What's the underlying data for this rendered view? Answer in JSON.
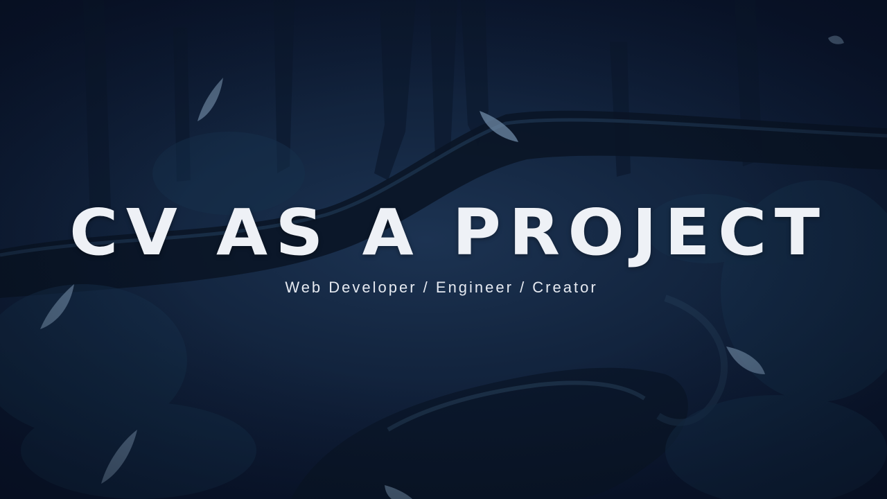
{
  "hero": {
    "title": "CV AS A PROJECT",
    "subtitle": "Web Developer / Engineer / Creator"
  },
  "colors": {
    "background": "#13253f",
    "text": "#eef1f6",
    "leaf": "#6f8aa6"
  }
}
